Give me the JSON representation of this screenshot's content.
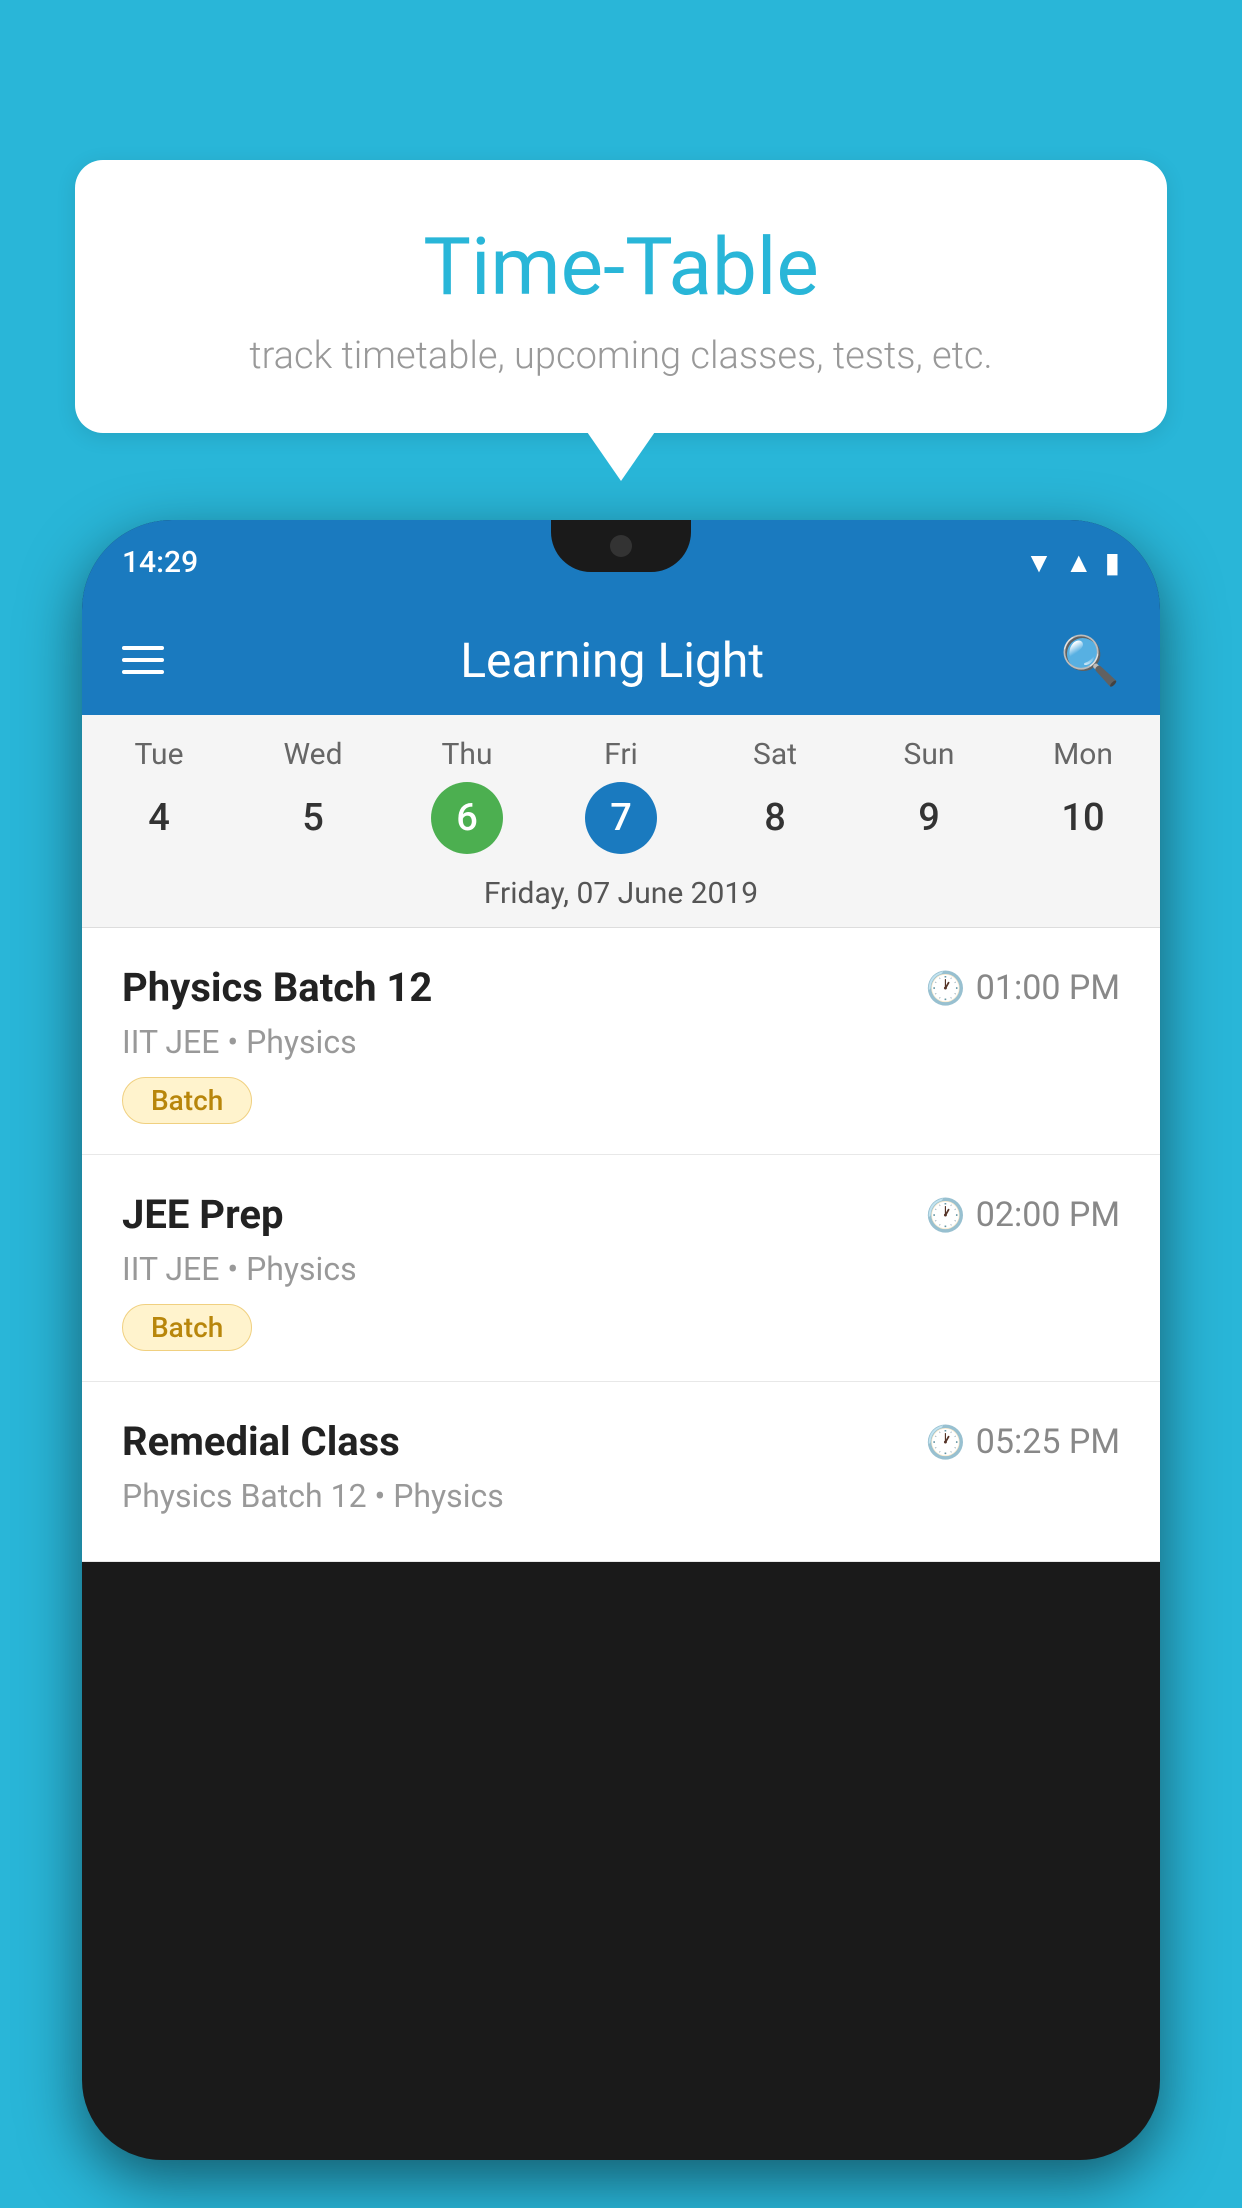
{
  "page": {
    "background_color": "#29b6d8"
  },
  "speech_bubble": {
    "title": "Time-Table",
    "subtitle": "track timetable, upcoming classes, tests, etc."
  },
  "phone": {
    "status_bar": {
      "time": "14:29"
    },
    "app_header": {
      "title": "Learning Light",
      "menu_label": "menu",
      "search_label": "search"
    },
    "calendar": {
      "days": [
        {
          "name": "Tue",
          "number": "4",
          "state": "normal"
        },
        {
          "name": "Wed",
          "number": "5",
          "state": "normal"
        },
        {
          "name": "Thu",
          "number": "6",
          "state": "today-green"
        },
        {
          "name": "Fri",
          "number": "7",
          "state": "selected-blue"
        },
        {
          "name": "Sat",
          "number": "8",
          "state": "normal"
        },
        {
          "name": "Sun",
          "number": "9",
          "state": "normal"
        },
        {
          "name": "Mon",
          "number": "10",
          "state": "normal"
        }
      ],
      "selected_date_label": "Friday, 07 June 2019"
    },
    "schedule_items": [
      {
        "title": "Physics Batch 12",
        "time": "01:00 PM",
        "subtitle": "IIT JEE • Physics",
        "badge": "Batch"
      },
      {
        "title": "JEE Prep",
        "time": "02:00 PM",
        "subtitle": "IIT JEE • Physics",
        "badge": "Batch"
      },
      {
        "title": "Remedial Class",
        "time": "05:25 PM",
        "subtitle": "Physics Batch 12 • Physics",
        "badge": null
      }
    ]
  }
}
